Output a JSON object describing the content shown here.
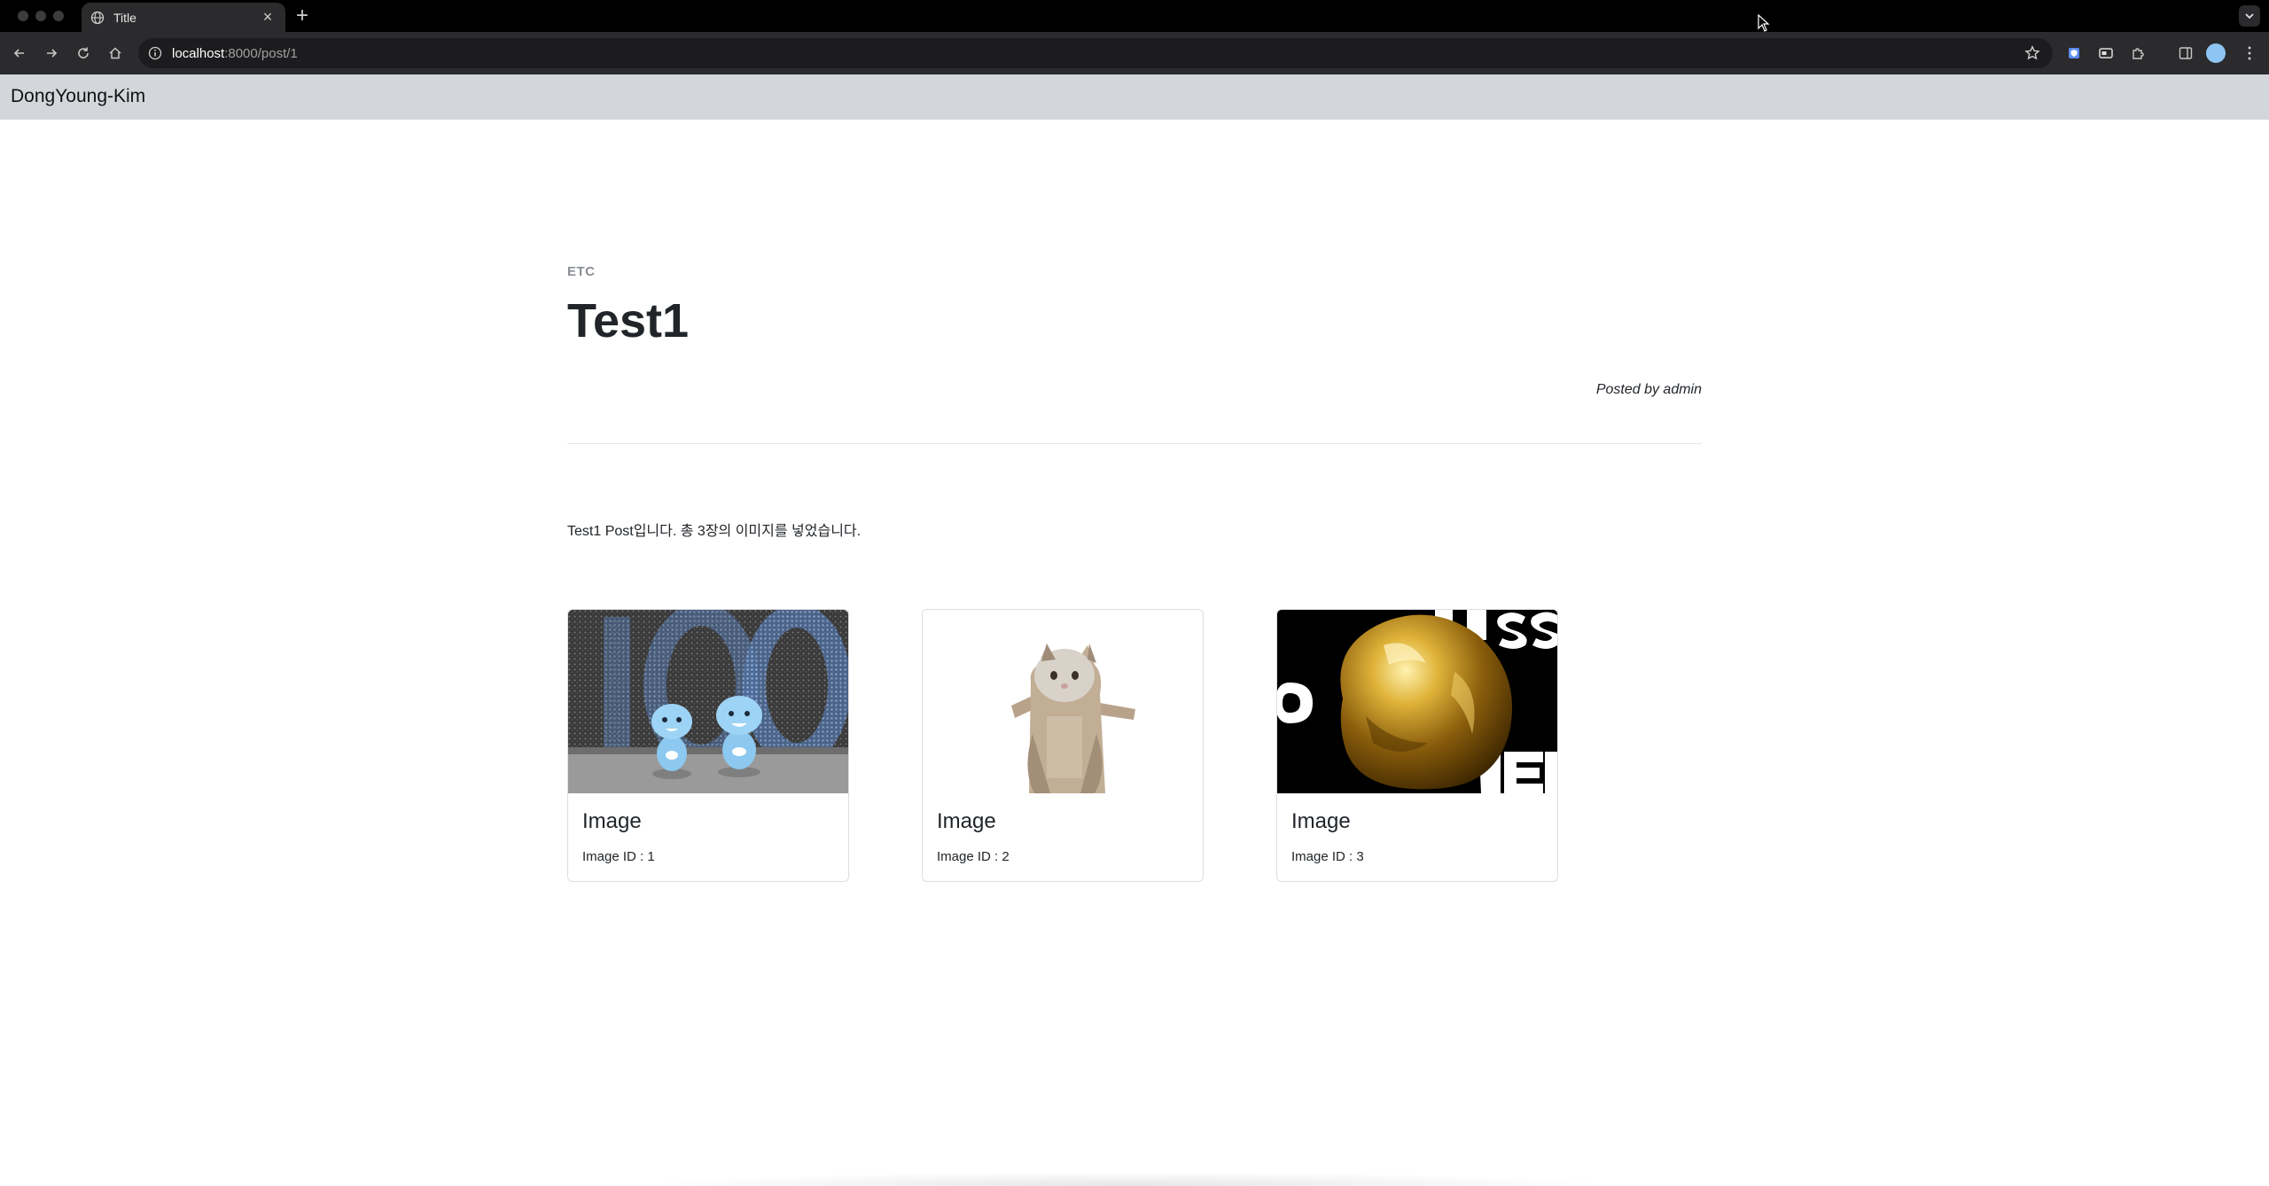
{
  "browser": {
    "tab_title": "Title",
    "tab_close": "×",
    "new_tab": "+",
    "url_host": "localhost",
    "url_path": ":8000/post/1"
  },
  "navbar": {
    "brand": "DongYoung-Kim"
  },
  "post": {
    "category": "ETC",
    "title": "Test1",
    "byline_prefix": "Posted by ",
    "author": "admin",
    "body": "Test1 Post입니다. 총 3장의 이미지를 넣었습니다."
  },
  "cards": [
    {
      "title": "Image",
      "text": "Image ID : 1",
      "image_desc": "two blue mascot figurines in front of a large 100 sign"
    },
    {
      "title": "Image",
      "text": "Image ID : 2",
      "image_desc": "gray and white cat standing upright"
    },
    {
      "title": "Image",
      "text": "Image ID : 3",
      "image_desc": "shiny golden blob on black background with white letters"
    }
  ],
  "colors": {
    "navbar_bg": "#d3d7dc",
    "chrome_bg": "#000000",
    "toolbar_bg": "#2b2b2d"
  }
}
